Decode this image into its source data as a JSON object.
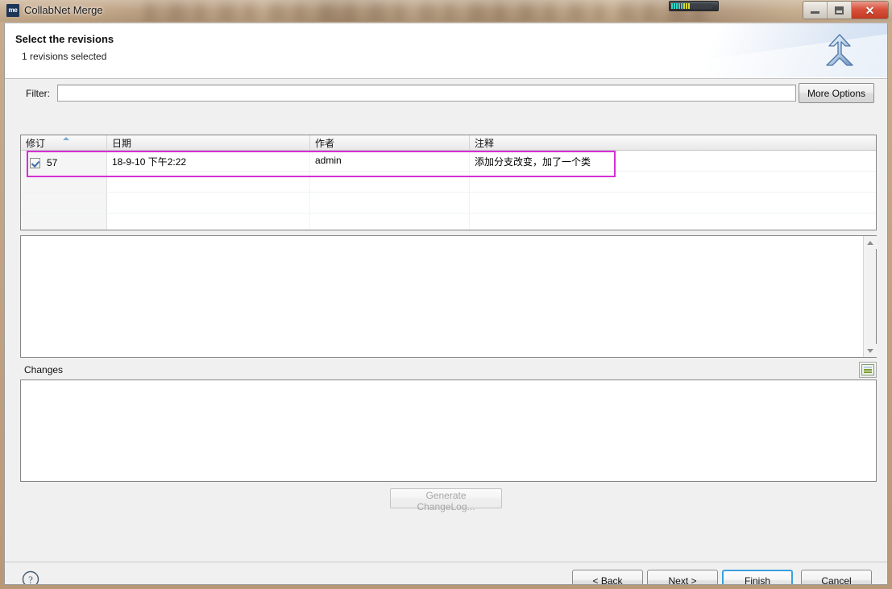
{
  "window": {
    "title": "CollabNet Merge",
    "app_icon_text": "me",
    "controls": {
      "minimize": "minimize-button",
      "maximize": "maximize-button",
      "close": "✕"
    }
  },
  "header": {
    "title": "Select the revisions",
    "subtitle": "1 revisions selected",
    "banner_icon": "merge-arrow-icon"
  },
  "filter": {
    "label": "Filter:",
    "value": "",
    "placeholder": "",
    "more_options_label": "More Options"
  },
  "revisions_table": {
    "columns": [
      {
        "key": "revision",
        "label": "修订",
        "sorted": "asc"
      },
      {
        "key": "date",
        "label": "日期"
      },
      {
        "key": "author",
        "label": "作者"
      },
      {
        "key": "comment",
        "label": "注释"
      }
    ],
    "rows": [
      {
        "checked": true,
        "revision": "57",
        "date": "18-9-10 下午2:22",
        "author": "admin",
        "comment": "添加分支改变，加了一个类"
      },
      {
        "checked": null,
        "revision": "",
        "date": "",
        "author": "",
        "comment": ""
      },
      {
        "checked": null,
        "revision": "",
        "date": "",
        "author": "",
        "comment": ""
      },
      {
        "checked": null,
        "revision": "",
        "date": "",
        "author": "",
        "comment": ""
      }
    ],
    "highlight_color": "#d42fd4"
  },
  "log_message_panel": {
    "text": ""
  },
  "changes_section": {
    "label": "Changes",
    "toggle_icon": "table-layout-icon",
    "content": ""
  },
  "generate_changelog": {
    "label": "Generate ChangeLog...",
    "enabled": false
  },
  "footer": {
    "help_icon": "help-question-icon",
    "buttons": [
      {
        "id": "back",
        "label": "< Back",
        "default": false
      },
      {
        "id": "next",
        "label": "Next >",
        "default": false
      },
      {
        "id": "finish",
        "label": "Finish",
        "default": true
      },
      {
        "id": "cancel",
        "label": "Cancel",
        "default": false
      }
    ]
  },
  "colors": {
    "accent": "#3aa0dd",
    "annotation": "#d42fd4",
    "frame": "#c2a383",
    "panel_bg": "#f0f0f0"
  }
}
